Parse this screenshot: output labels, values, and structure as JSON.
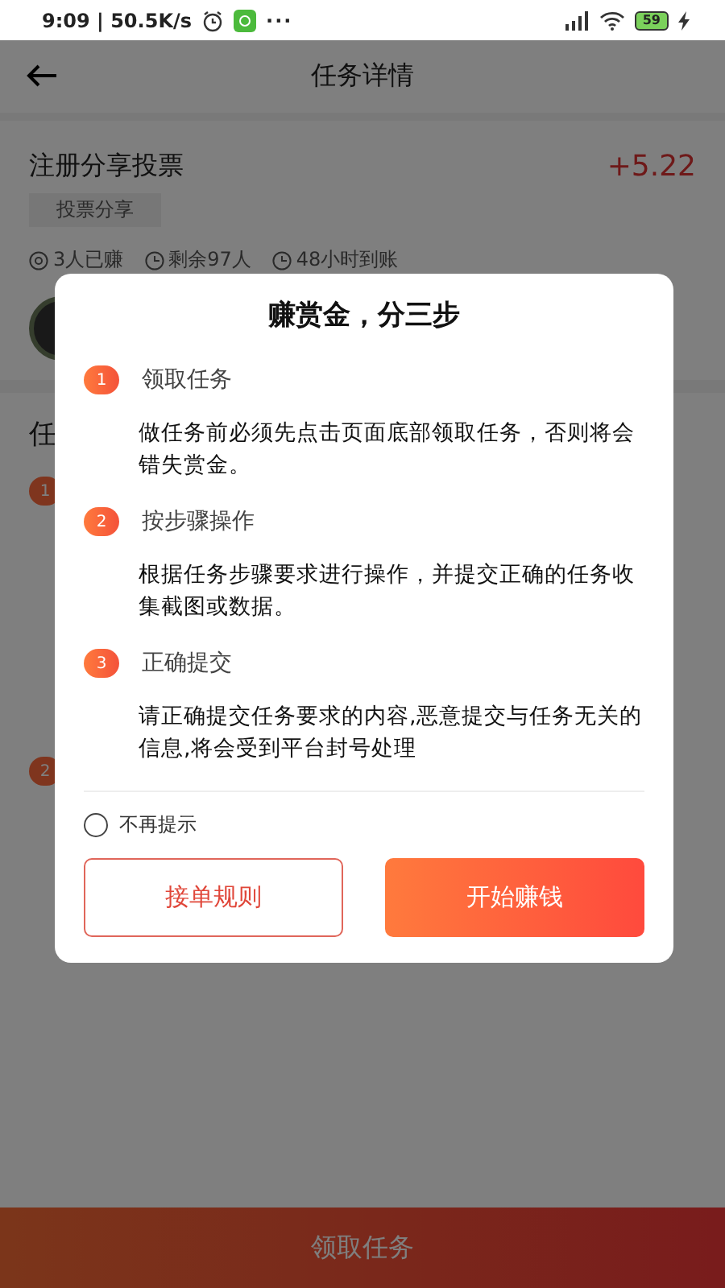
{
  "status_bar": {
    "time": "9:09 | 50.5K/s",
    "more": "···",
    "battery": "59"
  },
  "header": {
    "title": "任务详情"
  },
  "task": {
    "title": "注册分享投票",
    "reward": "+5.22",
    "tag": "投票分享",
    "stats": [
      {
        "kind": "views",
        "text": "3人已赚"
      },
      {
        "kind": "clock",
        "text": "剩余97人"
      },
      {
        "kind": "clock",
        "text": "48小时到账"
      }
    ]
  },
  "steps_section": {
    "title": "任",
    "badges": [
      "1",
      "2"
    ]
  },
  "dialog": {
    "title": "赚赏金，分三步",
    "steps": [
      {
        "number": "1",
        "label": "领取任务",
        "text": "做任务前必须先点击页面底部领取任务，否则将会错失赏金。"
      },
      {
        "number": "2",
        "label": "按步骤操作",
        "text": "根据任务步骤要求进行操作，并提交正确的任务收集截图或数据。"
      },
      {
        "number": "3",
        "label": "正确提交",
        "text": "请正确提交任务要求的内容,恶意提交与任务无关的信息,将会受到平台封号处理"
      }
    ],
    "dont_remind": {
      "label": "不再提示",
      "checked": false
    },
    "buttons": [
      {
        "kind": "outline",
        "label": "接单规则"
      },
      {
        "kind": "primary",
        "label": "开始赚钱"
      }
    ]
  },
  "bottom_button": {
    "label": "领取任务"
  }
}
